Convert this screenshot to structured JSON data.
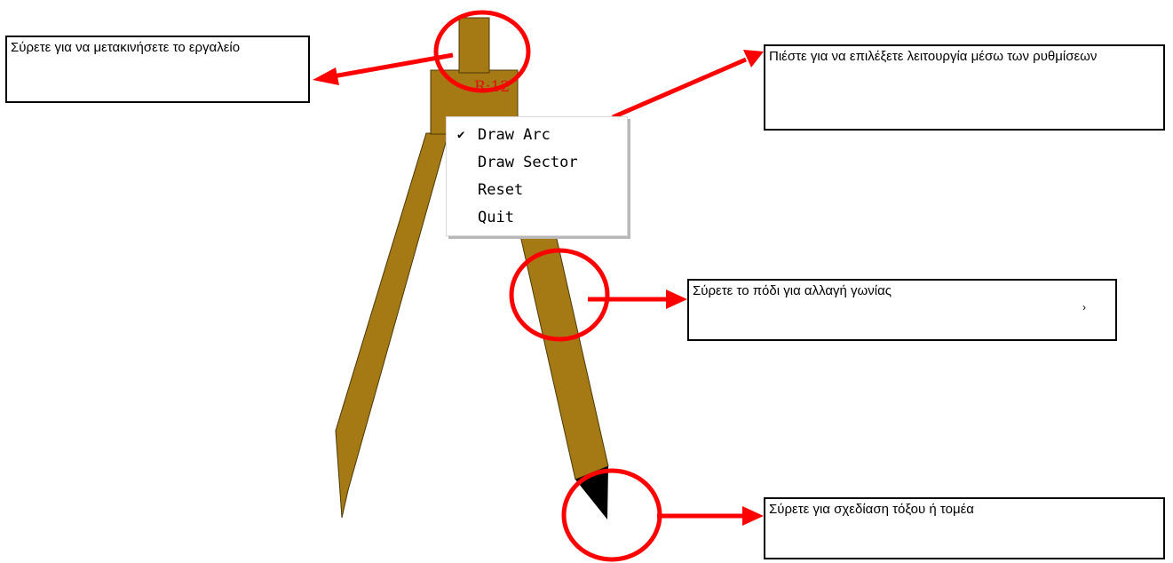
{
  "colors": {
    "wood": "#A57A14",
    "wood_outline": "#4a3808",
    "annotation_red": "#FF0000",
    "radius_label": "#E01010",
    "pencil_tip": "#000000"
  },
  "compass": {
    "radius_label": "R:12"
  },
  "context_menu": {
    "items": [
      {
        "label": "Draw Arc",
        "checked": true,
        "check_icon": "✔"
      },
      {
        "label": "Draw Sector",
        "checked": false,
        "check_icon": ""
      },
      {
        "label": "Reset",
        "checked": false,
        "check_icon": ""
      },
      {
        "label": "Quit",
        "checked": false,
        "check_icon": ""
      }
    ]
  },
  "callouts": {
    "move": "Σύρετε για να μετακινήσετε το εργαλείο",
    "mode": "Πιέστε για να επιλέξετε λειτουργία μέσω των ρυθμίσεων",
    "angle": "Σύρετε το πόδι για αλλαγή γωνίας",
    "draw": "Σύρετε για σχεδίαση τόξου ή τομέα"
  },
  "stray_mark": "›"
}
